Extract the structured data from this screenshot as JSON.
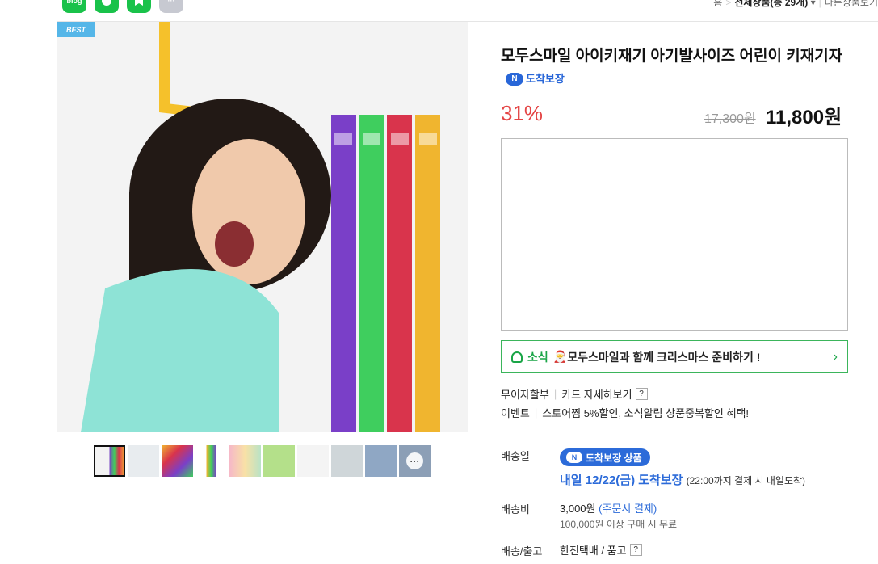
{
  "share": [
    {
      "name": "blog",
      "label": "blog"
    },
    {
      "name": "talk",
      "label": ""
    },
    {
      "name": "bookmark",
      "label": ""
    },
    {
      "name": "more",
      "label": "···"
    }
  ],
  "breadcrumb": {
    "home": "홈",
    "category": "전체상품(총 29개)",
    "other": "다른상품보기"
  },
  "product": {
    "best_badge": "BEST",
    "title": "모두스마일 아이키재기 아기발사이즈 어린이 키재기자",
    "arrival_badge": "도착보장",
    "discount": "31%",
    "original_price": "17,300원",
    "price": "11,800원"
  },
  "news": {
    "label": "소식",
    "text": "모두스마일과 함께 크리스마스 준비하기 !"
  },
  "benefits": {
    "installment_label": "무이자할부",
    "card_detail": "카드 자세히보기",
    "event_label": "이벤트",
    "event_text": "스토어찜 5%할인, 소식알림 상품중복할인 혜택!"
  },
  "delivery": {
    "date_label": "배송일",
    "pill": "도착보장 상품",
    "arrival": "내일 12/22(금) 도착보장",
    "arrival_note": "(22:00까지 결제 시 내일도착)",
    "fee_label": "배송비",
    "fee": "3,000원",
    "fee_note": "(주문시 결제)",
    "free_note": "100,000원 이상 구매 시 무료",
    "ship_label": "배송/출고",
    "carrier": "한진택배 / 품고"
  },
  "thumbnails": 10,
  "colors": {
    "accent_green": "#19c24a",
    "price_red": "#e44545",
    "link_blue": "#2c6bd9"
  }
}
